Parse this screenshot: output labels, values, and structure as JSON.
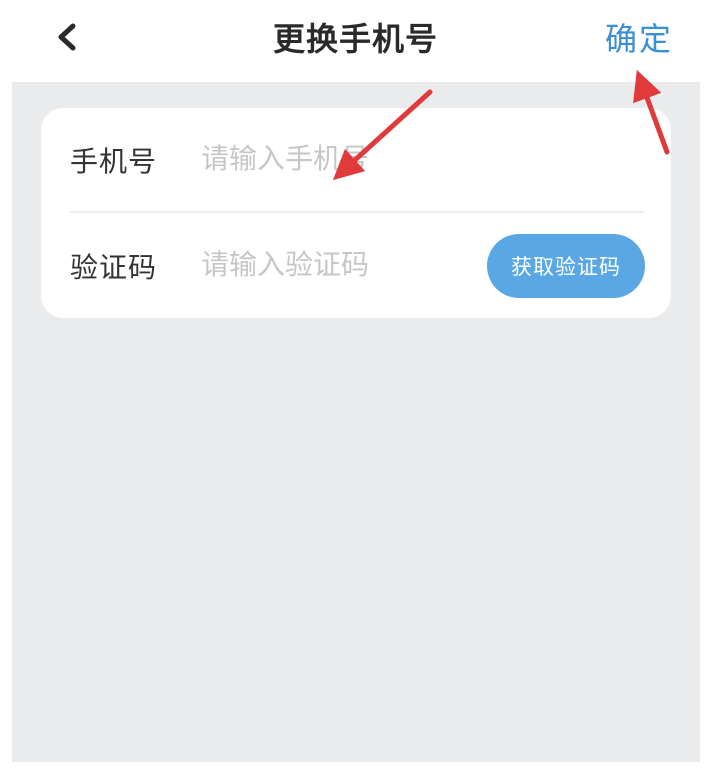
{
  "header": {
    "title": "更换手机号",
    "confirm_label": "确定",
    "back_icon": "chevron-left-icon"
  },
  "form": {
    "phone_label": "手机号",
    "phone_placeholder": "请输入手机号",
    "phone_value": "",
    "code_label": "验证码",
    "code_placeholder": "请输入验证码",
    "code_value": "",
    "get_code_label": "获取验证码"
  },
  "colors": {
    "accent": "#3a8fd6",
    "button": "#5aa7e6",
    "background": "#e9ebec",
    "annotation_arrow": "#e03a3a"
  }
}
